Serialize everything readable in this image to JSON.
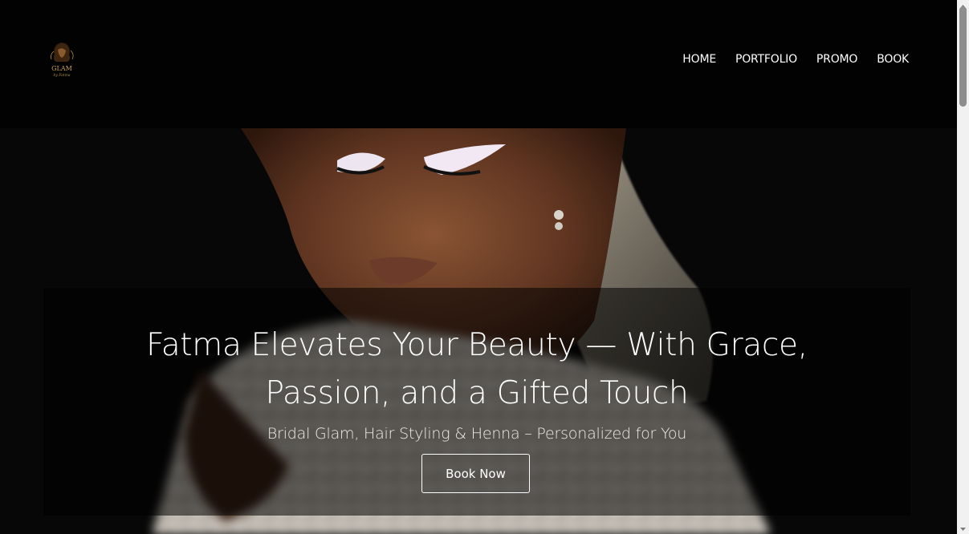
{
  "brand": {
    "logo_text": "GLAM",
    "logo_subtext": "by Fatma",
    "accent_color": "#b08a4a"
  },
  "nav": {
    "items": [
      {
        "label": "HOME"
      },
      {
        "label": "PORTFOLIO"
      },
      {
        "label": "PROMO"
      },
      {
        "label": "BOOK"
      }
    ]
  },
  "hero": {
    "headline_line1": "Fatma Elevates Your Beauty — With Grace,",
    "headline_line2": "Passion, and a Gifted Touch",
    "subheadline": "Bridal Glam, Hair Styling & Henna – Personalized for You",
    "cta_label": "Book Now",
    "image_icon": "bride-portrait-image"
  },
  "colors": {
    "background": "#020202",
    "text": "#ffffff",
    "overlay": "rgba(0,0,0,0.55)"
  }
}
